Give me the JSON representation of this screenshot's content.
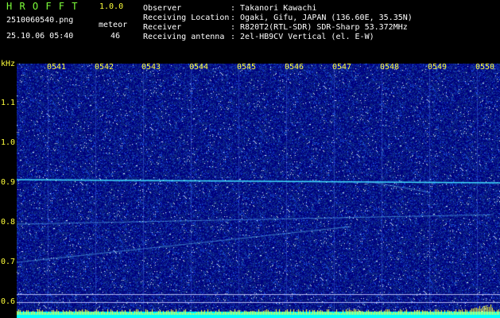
{
  "app": {
    "title": "H R O F F T",
    "version": "1.0.0"
  },
  "file": {
    "name": "2510060540.png",
    "datetime": "25.10.06 05:40"
  },
  "meteor": {
    "label": "meteor",
    "count": "46"
  },
  "info": {
    "observer_label": "Observer",
    "observer_value": ": Takanori Kawachi",
    "location_label": "Receiving Location",
    "location_value": ": Ogaki, Gifu, JAPAN (136.60E, 35.35N)",
    "receiver_label": "Receiver",
    "receiver_value": ": R820T2(RTL-SDR) SDR-Sharp 53.372MHz",
    "antenna_label": "Receiving antenna",
    "antenna_value": ": 2el-HB9CV Vertical (el. E-W)"
  },
  "axis": {
    "unit": "kHz",
    "y_ticks": [
      "1.1",
      "1.0",
      "0.9",
      "0.8",
      "0.7",
      "0.6"
    ],
    "time_ticks": [
      "0541",
      "0542",
      "0543",
      "0544",
      "0545",
      "0546",
      "0547",
      "0548",
      "0549",
      "0550"
    ]
  },
  "colors": {
    "background": "#000080",
    "noise": "#2060ff",
    "signal": "#40e0ff",
    "label": "#ffff3a",
    "title": "#7dff3a",
    "baseline": "#00ffff"
  }
}
